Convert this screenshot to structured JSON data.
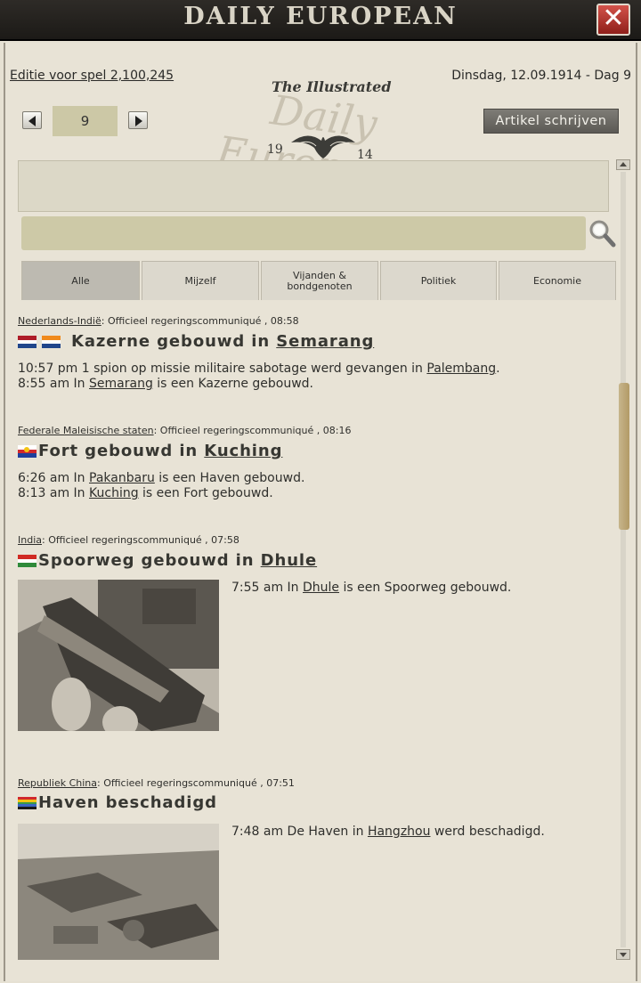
{
  "window": {
    "title": "DAILY EUROPEAN",
    "close_label": "✕"
  },
  "header": {
    "edition": "Editie voor spel 2,100,245",
    "date": "Dinsdag, 12.09.1914 - Dag 9",
    "logo": {
      "top_text": "The Illustrated",
      "big_text": "Daily European",
      "year_left": "19",
      "year_right": "14"
    }
  },
  "pager": {
    "page_value": "9"
  },
  "toolbar": {
    "write_article_label": "Artikel schrijven"
  },
  "search": {
    "value": "",
    "placeholder": ""
  },
  "tabs": [
    {
      "line1": "Alle",
      "line2": "",
      "active": true
    },
    {
      "line1": "Mijzelf",
      "line2": ""
    },
    {
      "line1": "Vijanden &",
      "line2": "bondgenoten"
    },
    {
      "line1": "Politiek",
      "line2": ""
    },
    {
      "line1": "Economie",
      "line2": ""
    }
  ],
  "articles": [
    {
      "nation": "Nederlands-Indië",
      "source": ": Officieel regeringscommuniqué , 08:58",
      "title_prefix": "Kazerne gebouwd in ",
      "title_place": "Semarang",
      "lines": [
        {
          "pre": "10:57 pm 1 spion op missie militaire sabotage werd gevangen in ",
          "link": "Palembang",
          "post": "."
        },
        {
          "pre": "8:55 am In ",
          "link": "Semarang",
          "post": " is een Kazerne gebouwd."
        }
      ]
    },
    {
      "nation": "Federale Maleisische staten",
      "source": ": Officieel regeringscommuniqué , 08:16",
      "title_prefix": "Fort gebouwd in ",
      "title_place": "Kuching",
      "lines": [
        {
          "pre": "6:26 am In ",
          "link": "Pakanbaru",
          "post": " is een Haven gebouwd."
        },
        {
          "pre": "8:13 am In ",
          "link": "Kuching",
          "post": " is een Fort gebouwd."
        }
      ]
    },
    {
      "nation": "India",
      "source": ": Officieel regeringscommuniqué , 07:58",
      "title_prefix": "Spoorweg gebouwd in ",
      "title_place": "Dhule",
      "lines": [
        {
          "pre": "7:55 am In ",
          "link": "Dhule",
          "post": " is een Spoorweg gebouwd."
        }
      ]
    },
    {
      "nation": "Republiek China",
      "source": ": Officieel regeringscommuniqué , 07:51",
      "title_prefix": "Haven beschadigd",
      "title_place": "",
      "lines": [
        {
          "pre": "7:48 am De Haven in ",
          "link": "Hangzhou",
          "post": " werd beschadigd."
        }
      ]
    }
  ],
  "colors": {
    "paper": "#e8e3d6",
    "input": "#cdc9a7",
    "scroll_thumb": "#b29a66",
    "close": "#b8352d"
  },
  "scroll": {
    "position": 0.27
  }
}
